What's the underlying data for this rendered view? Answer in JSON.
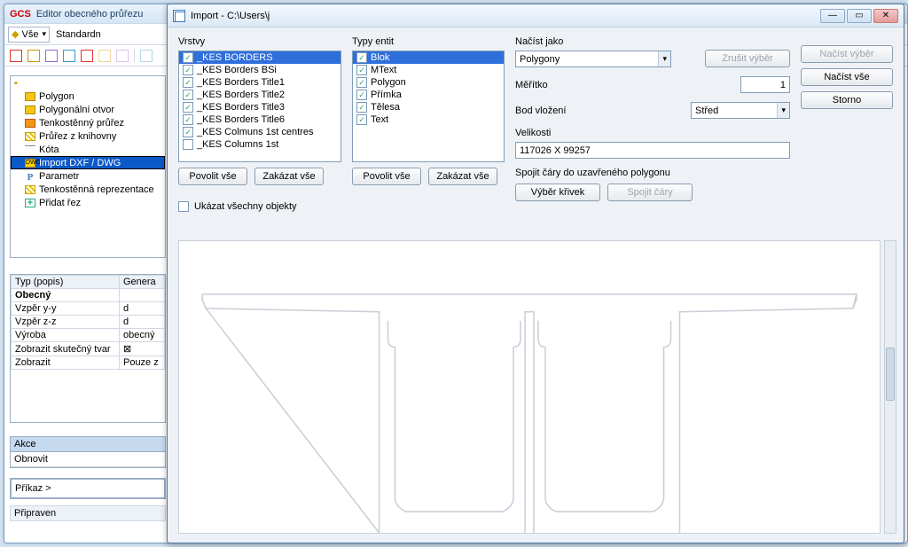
{
  "editor": {
    "logo": "GCS",
    "title": "Editor obecného průřezu",
    "combo_filter": "Vše",
    "combo_std": "Standardn",
    "tree": {
      "items": [
        "Polygon",
        "Polygonální otvor",
        "Tenkostěnný průřez",
        "Průřez z knihovny",
        "Kóta",
        "Import DXF / DWG",
        "Parametr",
        "Tenkostěnná reprezentace",
        "Přidat řez"
      ],
      "selected_index": 5
    },
    "props": {
      "col1": "Typ (popis)",
      "col2": "Genera",
      "rows": [
        {
          "k": "Obecný",
          "v": "",
          "bold": true
        },
        {
          "k": "Vzpěr y-y",
          "v": "d"
        },
        {
          "k": "Vzpěr z-z",
          "v": "d"
        },
        {
          "k": "Výroba",
          "v": "obecný"
        },
        {
          "k": "Zobrazit skutečný tvar",
          "v": "⊠"
        },
        {
          "k": "Zobrazit",
          "v": "Pouze z"
        }
      ]
    },
    "actions": {
      "header": "Akce",
      "row": "Obnovit"
    },
    "command": "Příkaz >",
    "status": "Připraven"
  },
  "import": {
    "title": "Import - C:\\Users\\j",
    "layers": {
      "label": "Vrstvy",
      "items": [
        "_KES BORDERS",
        "_KES Borders BSi",
        "_KES Borders Title1",
        "_KES Borders Title2",
        "_KES Borders Title3",
        "_KES Borders Title6",
        "_KES Colmuns 1st centres",
        "_KES Columns 1st"
      ],
      "allow": "Povolit vše",
      "deny": "Zakázat vše"
    },
    "types": {
      "label": "Typy entit",
      "items": [
        "Blok",
        "MText",
        "Polygon",
        "Přímka",
        "Tělesa",
        "Text"
      ],
      "allow": "Povolit vše",
      "deny": "Zakázat vše"
    },
    "showall": "Ukázat všechny objekty",
    "opts": {
      "load_as": "Načíst jako",
      "load_as_val": "Polygony",
      "cancel_sel": "Zrušit výběr",
      "scale": "Měřítko",
      "scale_val": "1",
      "insert": "Bod vložení",
      "insert_val": "Střed",
      "size": "Velikosti",
      "size_val": "117026 X 99257",
      "join_label": "Spojit čáry do uzavřeného polygonu",
      "pick": "Výběr křivek",
      "join": "Spojit čáry"
    },
    "buttons": {
      "load_sel": "Načíst výběr",
      "load_all": "Načíst vše",
      "storno": "Storno"
    }
  }
}
